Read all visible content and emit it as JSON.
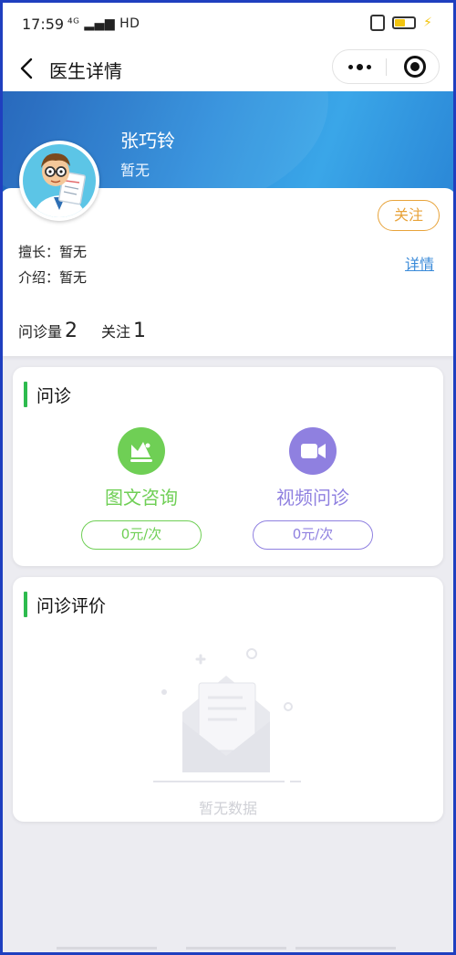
{
  "status_bar": {
    "time": "17:59",
    "network": "⁴ᴳ ▂▄▆ HD"
  },
  "nav": {
    "title": "医生详情"
  },
  "doctor": {
    "name": "张巧铃",
    "subtitle": "暂无",
    "follow_button": "关注",
    "specialty_label": "擅长：",
    "specialty_value": "暂无",
    "intro_label": "介绍：",
    "intro_value": "暂无",
    "detail_link": "详情"
  },
  "stats": {
    "consult_label": "问诊量",
    "consult_count": "2",
    "follow_label": "关注",
    "follow_count": "1"
  },
  "consultation": {
    "title": "问诊",
    "services": [
      {
        "name": "图文咨询",
        "price": "0元/次",
        "color": "#6fcf55",
        "icon": "image-text-icon"
      },
      {
        "name": "视频问诊",
        "price": "0元/次",
        "color": "#8f80e0",
        "icon": "video-camera-icon"
      }
    ]
  },
  "reviews": {
    "title": "问诊评价",
    "empty_text": "暂无数据"
  }
}
